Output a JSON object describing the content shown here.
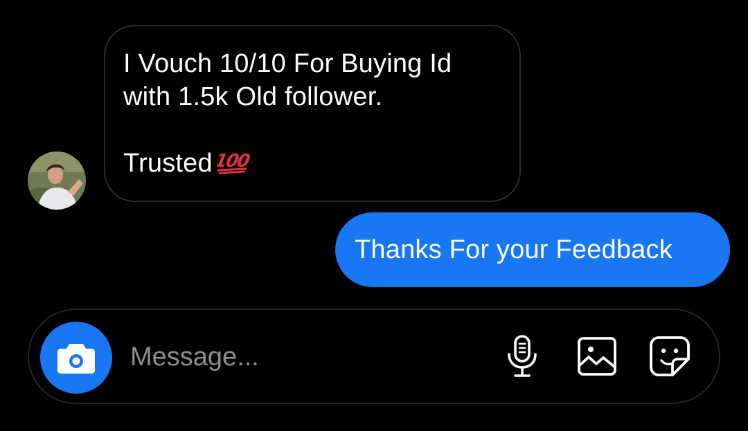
{
  "conversation": {
    "incoming": {
      "avatar_icon": "user-avatar-photo",
      "lines": [
        "I Vouch 10/10 For Buying Id",
        "with 1.5k Old follower.",
        "",
        "Trusted"
      ],
      "emoji": "💯"
    },
    "outgoing": {
      "text": "Thanks For your Feedback"
    }
  },
  "composer": {
    "placeholder": "Message...",
    "value": "",
    "icons": {
      "camera": "camera-icon",
      "microphone": "microphone-icon",
      "gallery": "image-gallery-icon",
      "sticker": "sticker-icon"
    }
  },
  "colors": {
    "background": "#000000",
    "outgoing_bubble": "#1877f2",
    "camera_button": "#1877f2",
    "incoming_border": "#2e2e2e",
    "composer_border": "#262626",
    "placeholder": "#8e8e8e",
    "emoji_red": "#e0323c"
  }
}
